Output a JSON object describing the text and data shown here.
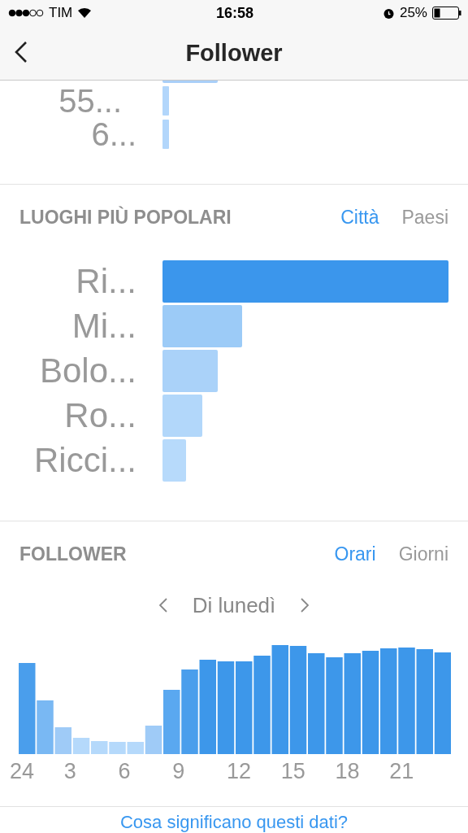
{
  "status_bar": {
    "carrier": "TIM",
    "time": "16:58",
    "battery": "25%"
  },
  "nav": {
    "title": "Follower"
  },
  "age_section": {
    "labels": [
      "55...",
      "6..."
    ]
  },
  "places_section": {
    "title": "LUOGHI PIÙ POPOLARI",
    "tabs": [
      {
        "label": "Città",
        "selected": true
      },
      {
        "label": "Paesi",
        "selected": false
      }
    ],
    "labels": [
      "Ri...",
      "Mi...",
      "Bolo...",
      "Ro...",
      "Ricci..."
    ]
  },
  "followers_section": {
    "title": "FOLLOWER",
    "tabs": [
      {
        "label": "Orari",
        "selected": true
      },
      {
        "label": "Giorni",
        "selected": false
      }
    ],
    "day": "Di lunedì",
    "hour_labels": [
      "24",
      "3",
      "6",
      "9",
      "12",
      "15",
      "18",
      "21"
    ]
  },
  "footer_link": "Cosa significano questi dati?"
}
